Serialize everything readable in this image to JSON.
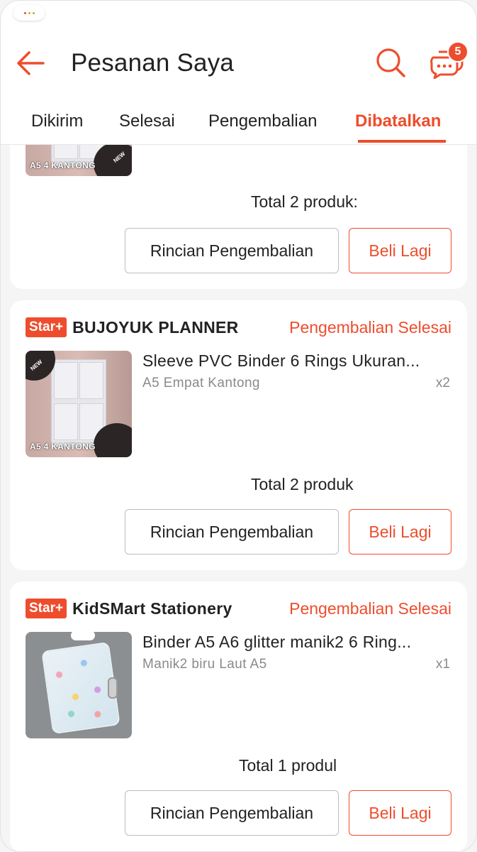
{
  "header": {
    "title": "Pesanan Saya",
    "chat_badge": "5"
  },
  "tabs": [
    {
      "label": "Dikirim"
    },
    {
      "label": "Selesai"
    },
    {
      "label": "Pengembalian"
    },
    {
      "label": "Dibatalkan",
      "active": true
    }
  ],
  "cards": [
    {
      "thumb_label": "A5 4 KANTONG",
      "thumb_new": "NEW",
      "total": "Total 2 produk:",
      "detail_button": "Rincian Pengembalian",
      "buy_button": "Beli Lagi"
    },
    {
      "badge": "Star+",
      "shop": "BUJOYUK PLANNER",
      "status": "Pengembalian Selesai",
      "thumb_label": "A5 4 KANTONG",
      "thumb_new": "NEW",
      "product": "Sleeve PVC Binder 6 Rings Ukuran...",
      "variant": "A5 Empat Kantong",
      "qty": "x2",
      "total": "Total 2 produk",
      "detail_button": "Rincian Pengembalian",
      "buy_button": "Beli Lagi"
    },
    {
      "badge": "Star+",
      "shop": "KidSMart Stationery",
      "status": "Pengembalian Selesai",
      "product": "Binder A5 A6 glitter manik2  6 Ring...",
      "variant": "Manik2 biru Laut A5",
      "qty": "x1",
      "total": "Total 1 produl",
      "detail_button": "Rincian Pengembalian",
      "buy_button": "Beli Lagi"
    }
  ],
  "colors": {
    "accent": "#ee4d2d",
    "background": "#f5f5f5",
    "muted_text": "#8a8a8a"
  },
  "icons": {
    "back": "arrow-left-icon",
    "search": "search-icon",
    "chat": "chat-bubble-icon"
  }
}
